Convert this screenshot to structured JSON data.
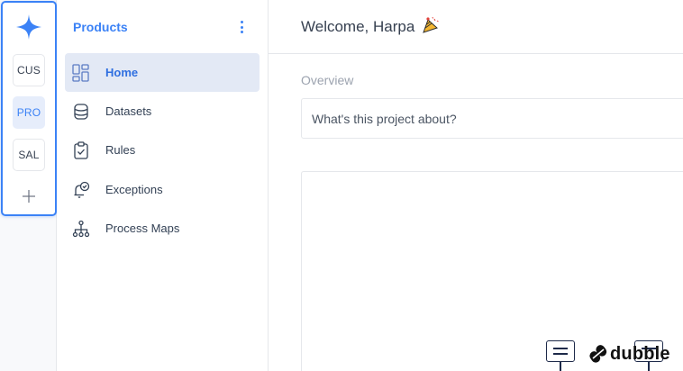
{
  "workspaces": [
    {
      "code": "CUS",
      "active": false
    },
    {
      "code": "PRO",
      "active": true
    },
    {
      "code": "SAL",
      "active": false
    }
  ],
  "sidebar": {
    "title": "Products",
    "items": [
      {
        "label": "Home",
        "icon": "dashboard-icon",
        "active": true
      },
      {
        "label": "Datasets",
        "icon": "database-icon",
        "active": false
      },
      {
        "label": "Rules",
        "icon": "clipboard-check-icon",
        "active": false
      },
      {
        "label": "Exceptions",
        "icon": "bell-check-icon",
        "active": false
      },
      {
        "label": "Process Maps",
        "icon": "sitemap-icon",
        "active": false
      }
    ]
  },
  "main": {
    "welcome": "Welcome, Harpa",
    "overview_label": "Overview",
    "about_placeholder": "What's this project about?"
  },
  "brand": {
    "name": "dubble"
  },
  "colors": {
    "accent": "#3b82f6",
    "active_nav_bg": "#e3e9f5",
    "border": "#e5e7eb"
  }
}
